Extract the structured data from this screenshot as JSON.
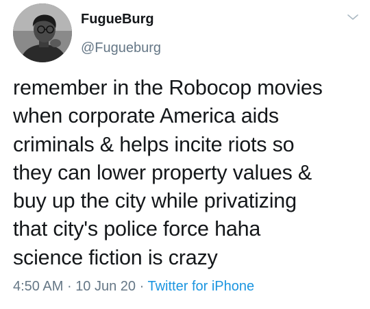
{
  "author": {
    "display_name": "FugueBurg",
    "handle": "@Fugueburg",
    "avatar_icon": "profile-photo"
  },
  "menu_icon": "chevron-down-icon",
  "tweet": {
    "lines": [
      "remember in the Robocop movies",
      "when corporate America aids",
      "criminals & helps incite riots so",
      "they can lower property values &",
      "buy up the city while privatizing",
      "that city's police force haha",
      "science fiction is crazy"
    ]
  },
  "meta": {
    "time": "4:50 AM",
    "separator": "·",
    "date": "10 Jun 20",
    "source": "Twitter for iPhone"
  },
  "colors": {
    "text": "#14171a",
    "secondary": "#657786",
    "link": "#1b95e0"
  }
}
